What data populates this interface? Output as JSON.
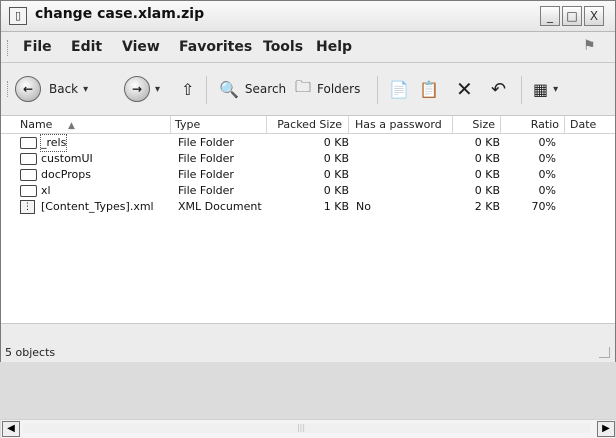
{
  "window": {
    "title": "change case.xlam.zip",
    "title_icon": "app-icon",
    "controls": [
      "_",
      "□",
      "X"
    ]
  },
  "menu": {
    "items": [
      "File",
      "Edit",
      "View",
      "Favorites",
      "Tools",
      "Help"
    ]
  },
  "toolbar": {
    "back_label": "Back",
    "search_label": "Search",
    "folders_label": "Folders"
  },
  "table": {
    "headers": [
      "Name",
      "Type",
      "Packed Size",
      "Has a password",
      "Size",
      "Ratio",
      "Date"
    ],
    "rows": [
      {
        "name": "_rels",
        "type": "File Folder",
        "packed": "0 KB",
        "password": "",
        "size": "0 KB",
        "ratio": "0%",
        "date": "",
        "icon": "folder-icon"
      },
      {
        "name": "customUI",
        "type": "File Folder",
        "packed": "0 KB",
        "password": "",
        "size": "0 KB",
        "ratio": "0%",
        "date": "",
        "icon": "folder-icon"
      },
      {
        "name": "docProps",
        "type": "File Folder",
        "packed": "0 KB",
        "password": "",
        "size": "0 KB",
        "ratio": "0%",
        "date": "",
        "icon": "folder-icon"
      },
      {
        "name": "xl",
        "type": "File Folder",
        "packed": "0 KB",
        "password": "",
        "size": "0 KB",
        "ratio": "0%",
        "date": "",
        "icon": "folder-icon"
      },
      {
        "name": "[Content_Types].xml",
        "type": "XML Document",
        "packed": "1 KB",
        "password": "No",
        "size": "2 KB",
        "ratio": "70%",
        "date": "",
        "icon": "xml-icon"
      }
    ]
  },
  "status": {
    "text": "5 objects"
  }
}
